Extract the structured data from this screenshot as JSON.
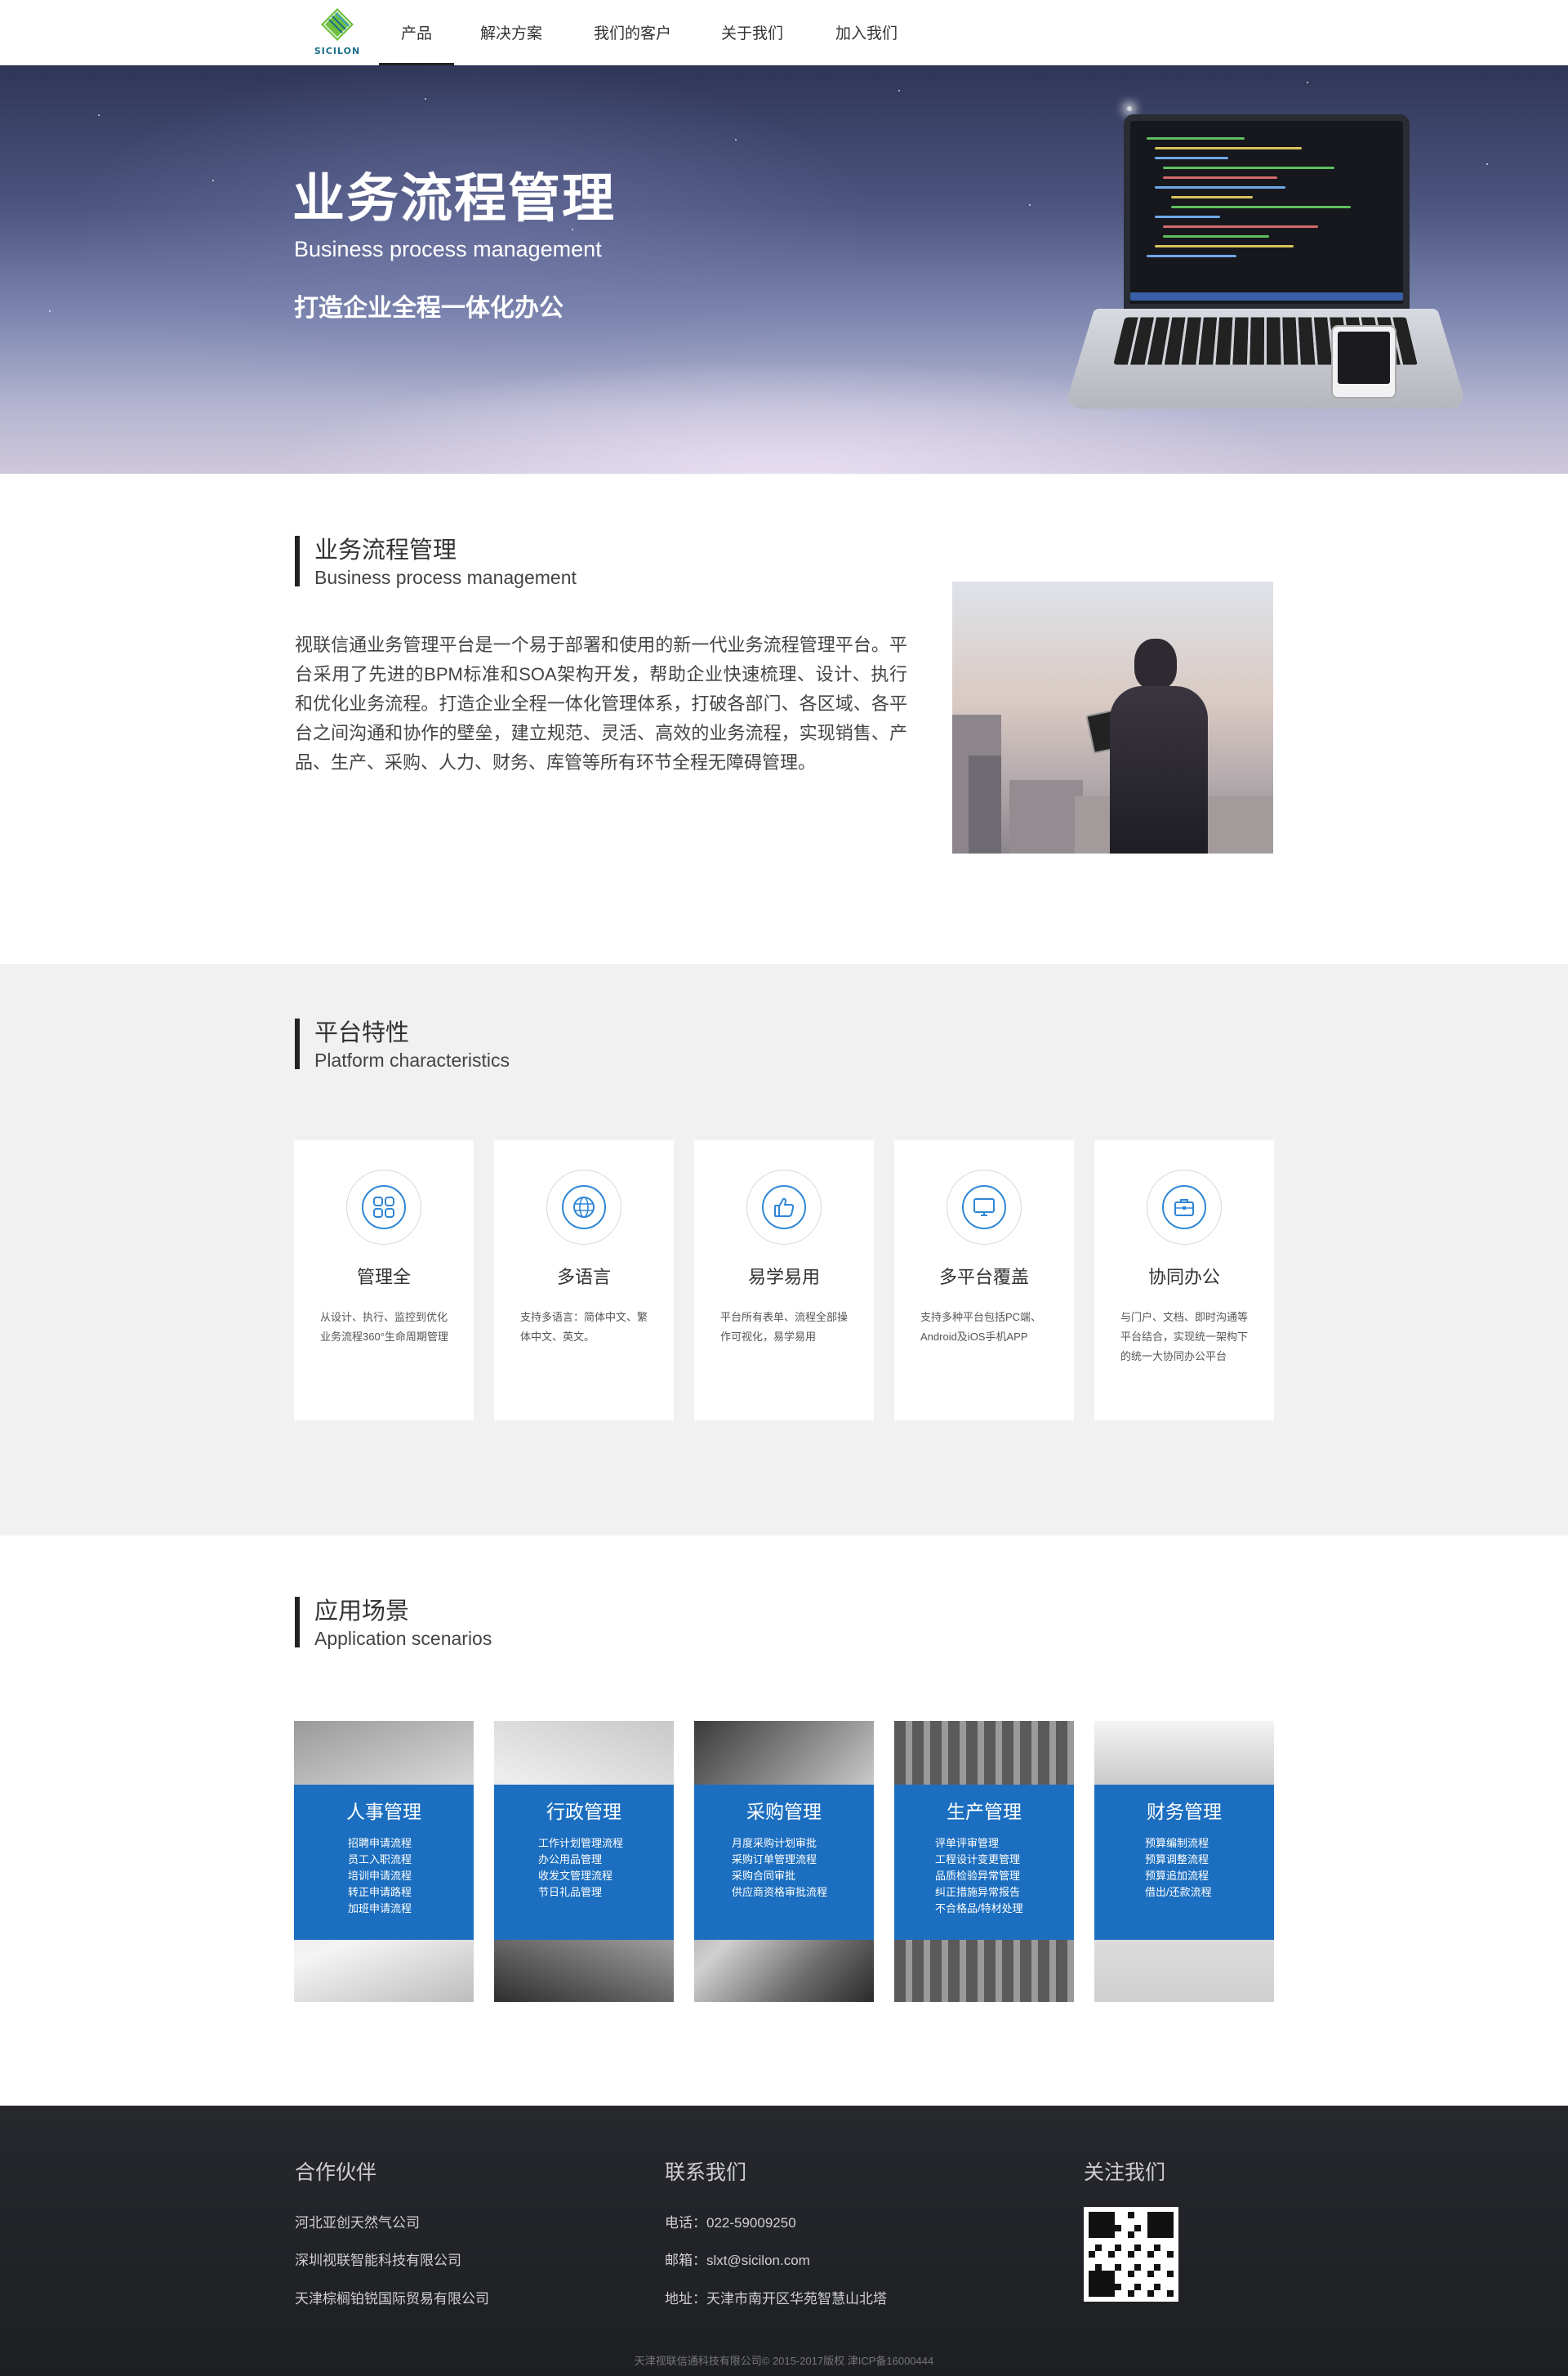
{
  "nav": {
    "logo_text": "SICILON",
    "items": [
      {
        "label": "产品",
        "active": true
      },
      {
        "label": "解决方案",
        "active": false
      },
      {
        "label": "我们的客户",
        "active": false
      },
      {
        "label": "关于我们",
        "active": false
      },
      {
        "label": "加入我们",
        "active": false
      }
    ]
  },
  "hero": {
    "title": "业务流程管理",
    "subtitle": "Business process management",
    "slogan": "打造企业全程一体化办公"
  },
  "intro": {
    "heading_zh": "业务流程管理",
    "heading_en": "Business process management",
    "paragraph": "视联信通业务管理平台是一个易于部署和使用的新一代业务流程管理平台。平台采用了先进的BPM标准和SOA架构开发，帮助企业快速梳理、设计、执行和优化业务流程。打造企业全程一体化管理体系，打破各部门、各区域、各平台之间沟通和协作的壁垒，建立规范、灵活、高效的业务流程，实现销售、产品、生产、采购、人力、财务、库管等所有环节全程无障碍管理。"
  },
  "features": {
    "heading_zh": "平台特性",
    "heading_en": "Platform characteristics",
    "cards": [
      {
        "icon": "grid-icon",
        "title": "管理全",
        "desc": "从设计、执行、监控到优化业务流程360°生命周期管理"
      },
      {
        "icon": "globe-icon",
        "title": "多语言",
        "desc": "支持多语言：简体中文、繁体中文、英文。"
      },
      {
        "icon": "thumbs-up-icon",
        "title": "易学易用",
        "desc": "平台所有表单、流程全部操作可视化，易学易用"
      },
      {
        "icon": "monitor-icon",
        "title": "多平台覆盖",
        "desc": "支持多种平台包括PC端、Android及iOS手机APP"
      },
      {
        "icon": "briefcase-icon",
        "title": "协同办公",
        "desc": "与门户、文档、即时沟通等平台结合，实现统一架构下的统一大协同办公平台"
      }
    ]
  },
  "scenarios": {
    "heading_zh": "应用场景",
    "heading_en": "Application scenarios",
    "items": [
      {
        "title": "人事管理",
        "list": [
          "招聘申请流程",
          "员工入职流程",
          "培训申请流程",
          "转正申请路程",
          "加班申请流程"
        ]
      },
      {
        "title": "行政管理",
        "list": [
          "工作计划管理流程",
          "办公用品管理",
          "收发文管理流程",
          "节日礼品管理"
        ]
      },
      {
        "title": "采购管理",
        "list": [
          "月度采购计划审批",
          "采购订单管理流程",
          "采购合同审批",
          "供应商资格审批流程"
        ]
      },
      {
        "title": "生产管理",
        "list": [
          "评单评审管理",
          "工程设计变更管理",
          "品质检验异常管理",
          "纠正措施异常报告",
          "不合格品/特材处理"
        ]
      },
      {
        "title": "财务管理",
        "list": [
          "预算编制流程",
          "预算调整流程",
          "预算追加流程",
          "借出/还款流程"
        ]
      }
    ]
  },
  "footer": {
    "partners_title": "合作伙伴",
    "partners": [
      "河北亚创天然气公司",
      "深圳视联智能科技有限公司",
      "天津棕榈铂锐国际贸易有限公司"
    ],
    "contact_title": "联系我们",
    "phone": "电话：022-59009250",
    "email": "邮箱：slxt@sicilon.com",
    "address": "地址：天津市南开区华苑智慧山北塔",
    "follow_title": "关注我们",
    "copyright": "天津视联信通科技有限公司© 2015-2017版权 津ICP备16000444"
  },
  "colors": {
    "accent_blue": "#1c6fc0",
    "icon_blue": "#2f86d6",
    "footer_bg": "#222429",
    "feature_bg": "#f1f1f1"
  }
}
